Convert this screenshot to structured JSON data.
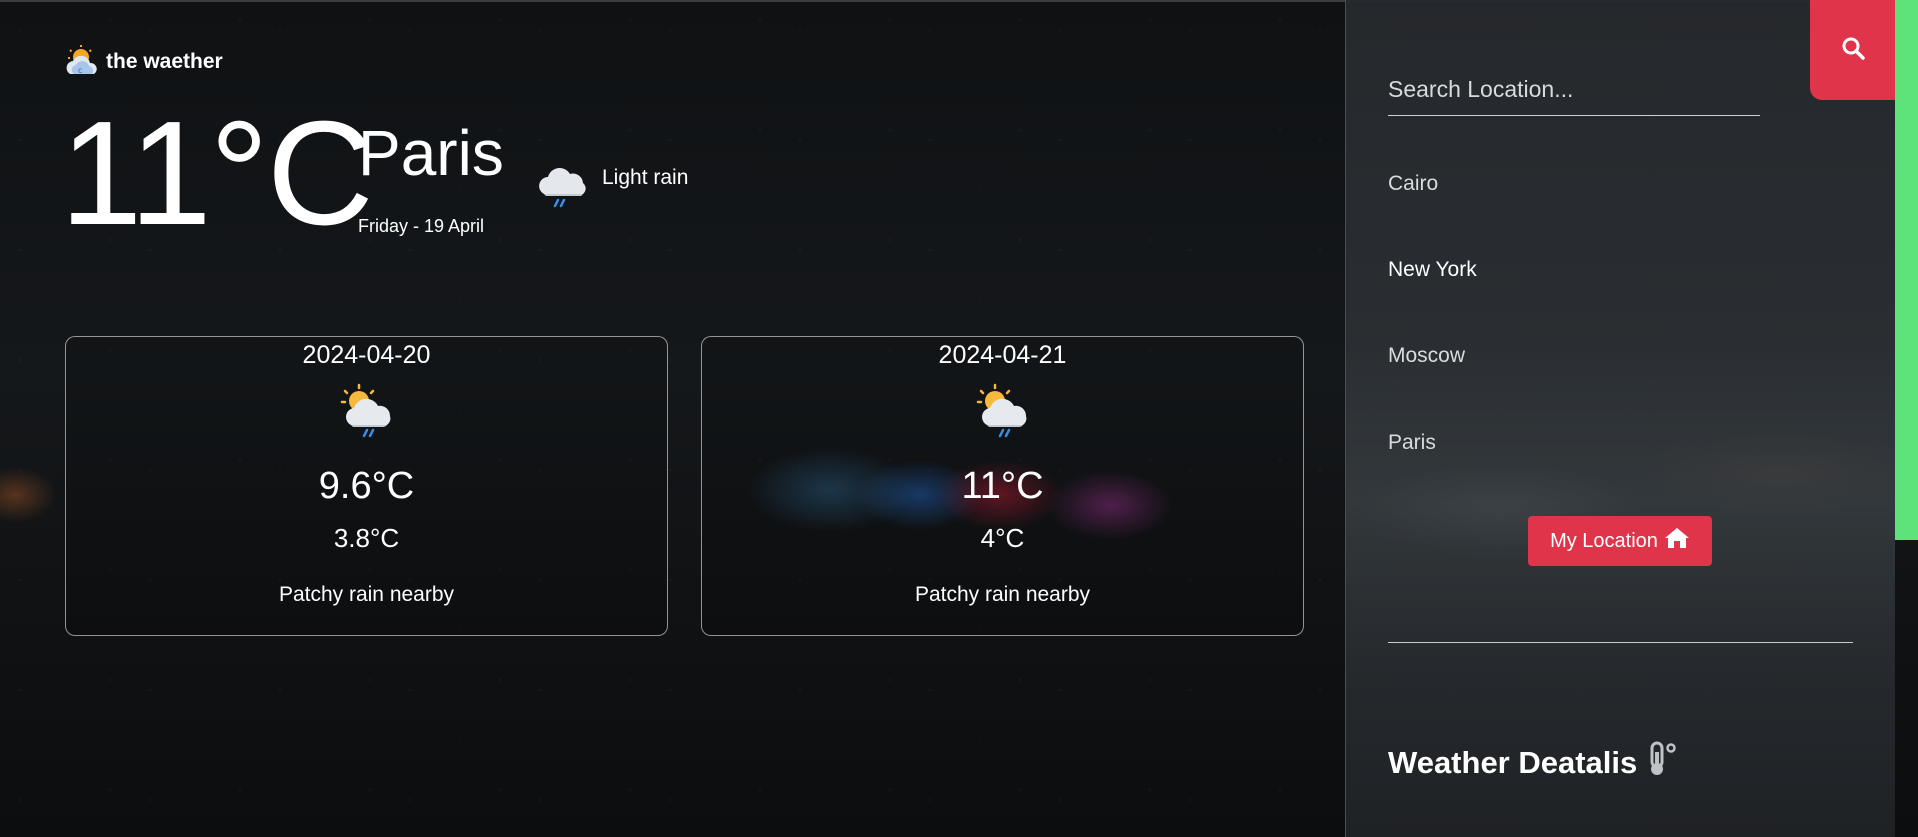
{
  "brand": {
    "name": "the waether",
    "icon": "sun-cloud-icon"
  },
  "current": {
    "temperature": "11°C",
    "city": "Paris",
    "date": "Friday - 19 April",
    "condition": "Light rain",
    "condition_icon": "rain-cloud-icon"
  },
  "forecast": [
    {
      "date": "2024-04-20",
      "max": "9.6°C",
      "min": "3.8°C",
      "condition": "Patchy rain nearby",
      "icon": "sun-cloud-rain-icon"
    },
    {
      "date": "2024-04-21",
      "max": "11°C",
      "min": "4°C",
      "condition": "Patchy rain nearby",
      "icon": "sun-cloud-rain-icon"
    }
  ],
  "sidebar": {
    "search_placeholder": "Search Location...",
    "search_icon": "search-icon",
    "locations": [
      "Cairo",
      "New York",
      "Moscow",
      "Paris"
    ],
    "my_location_label": "My Location",
    "my_location_icon": "home-icon",
    "details_title": "Weather Deatalis",
    "details_icon": "thermometer-icon"
  },
  "colors": {
    "accent": "#e0344b",
    "scrollbar": "#5ee27a",
    "panel": "#2a2d31"
  }
}
